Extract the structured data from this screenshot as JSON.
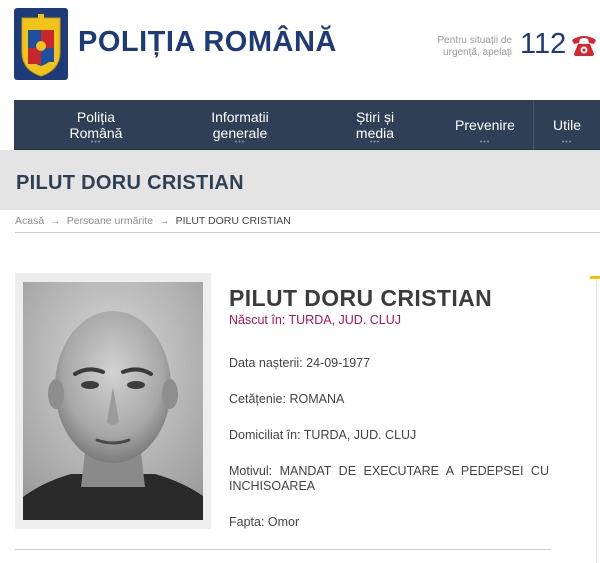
{
  "header": {
    "site_title": "POLIȚIA ROMÂNĂ",
    "emergency_line1": "Pentru situații de",
    "emergency_line2": "urgență, apelați",
    "emergency_number": "112"
  },
  "nav": {
    "items": [
      {
        "line1": "Poliția",
        "line2": "Română"
      },
      {
        "line1": "Informatii",
        "line2": "generale"
      },
      {
        "line1": "Știri și",
        "line2": "media"
      },
      {
        "line1": "Prevenire",
        "line2": ""
      },
      {
        "line1": "Utile",
        "line2": ""
      }
    ],
    "dots": "•••"
  },
  "page": {
    "title": "PILUT DORU CRISTIAN"
  },
  "breadcrumb": {
    "home": "Acasă",
    "section": "Persoane urmărite",
    "current": "PILUT DORU CRISTIAN",
    "arrow": "→"
  },
  "person": {
    "name": "PILUT DORU CRISTIAN",
    "born": "Născut în: TURDA, JUD. CLUJ",
    "birth_date_label": "Data nașterii:",
    "birth_date": "24-09-1977",
    "citizenship_label": "Cetățenie:",
    "citizenship": "ROMANA",
    "residence_label": "Domiciliat în:",
    "residence": "TURDA, JUD. CLUJ",
    "motive_label": "Motivul:",
    "motive": "MANDAT DE EXECUTARE A PEDEPSEI CU INCHISOAREA",
    "deed_label": "Fapta:",
    "deed": "Omor"
  },
  "colors": {
    "brand_blue": "#1d3b7a",
    "nav_bg": "#2f3f55",
    "phone_red": "#d9232e",
    "born_text": "#b0144c",
    "accent_yellow": "#f2c300"
  },
  "icons": [
    "coat-of-arms-icon",
    "phone-icon"
  ]
}
